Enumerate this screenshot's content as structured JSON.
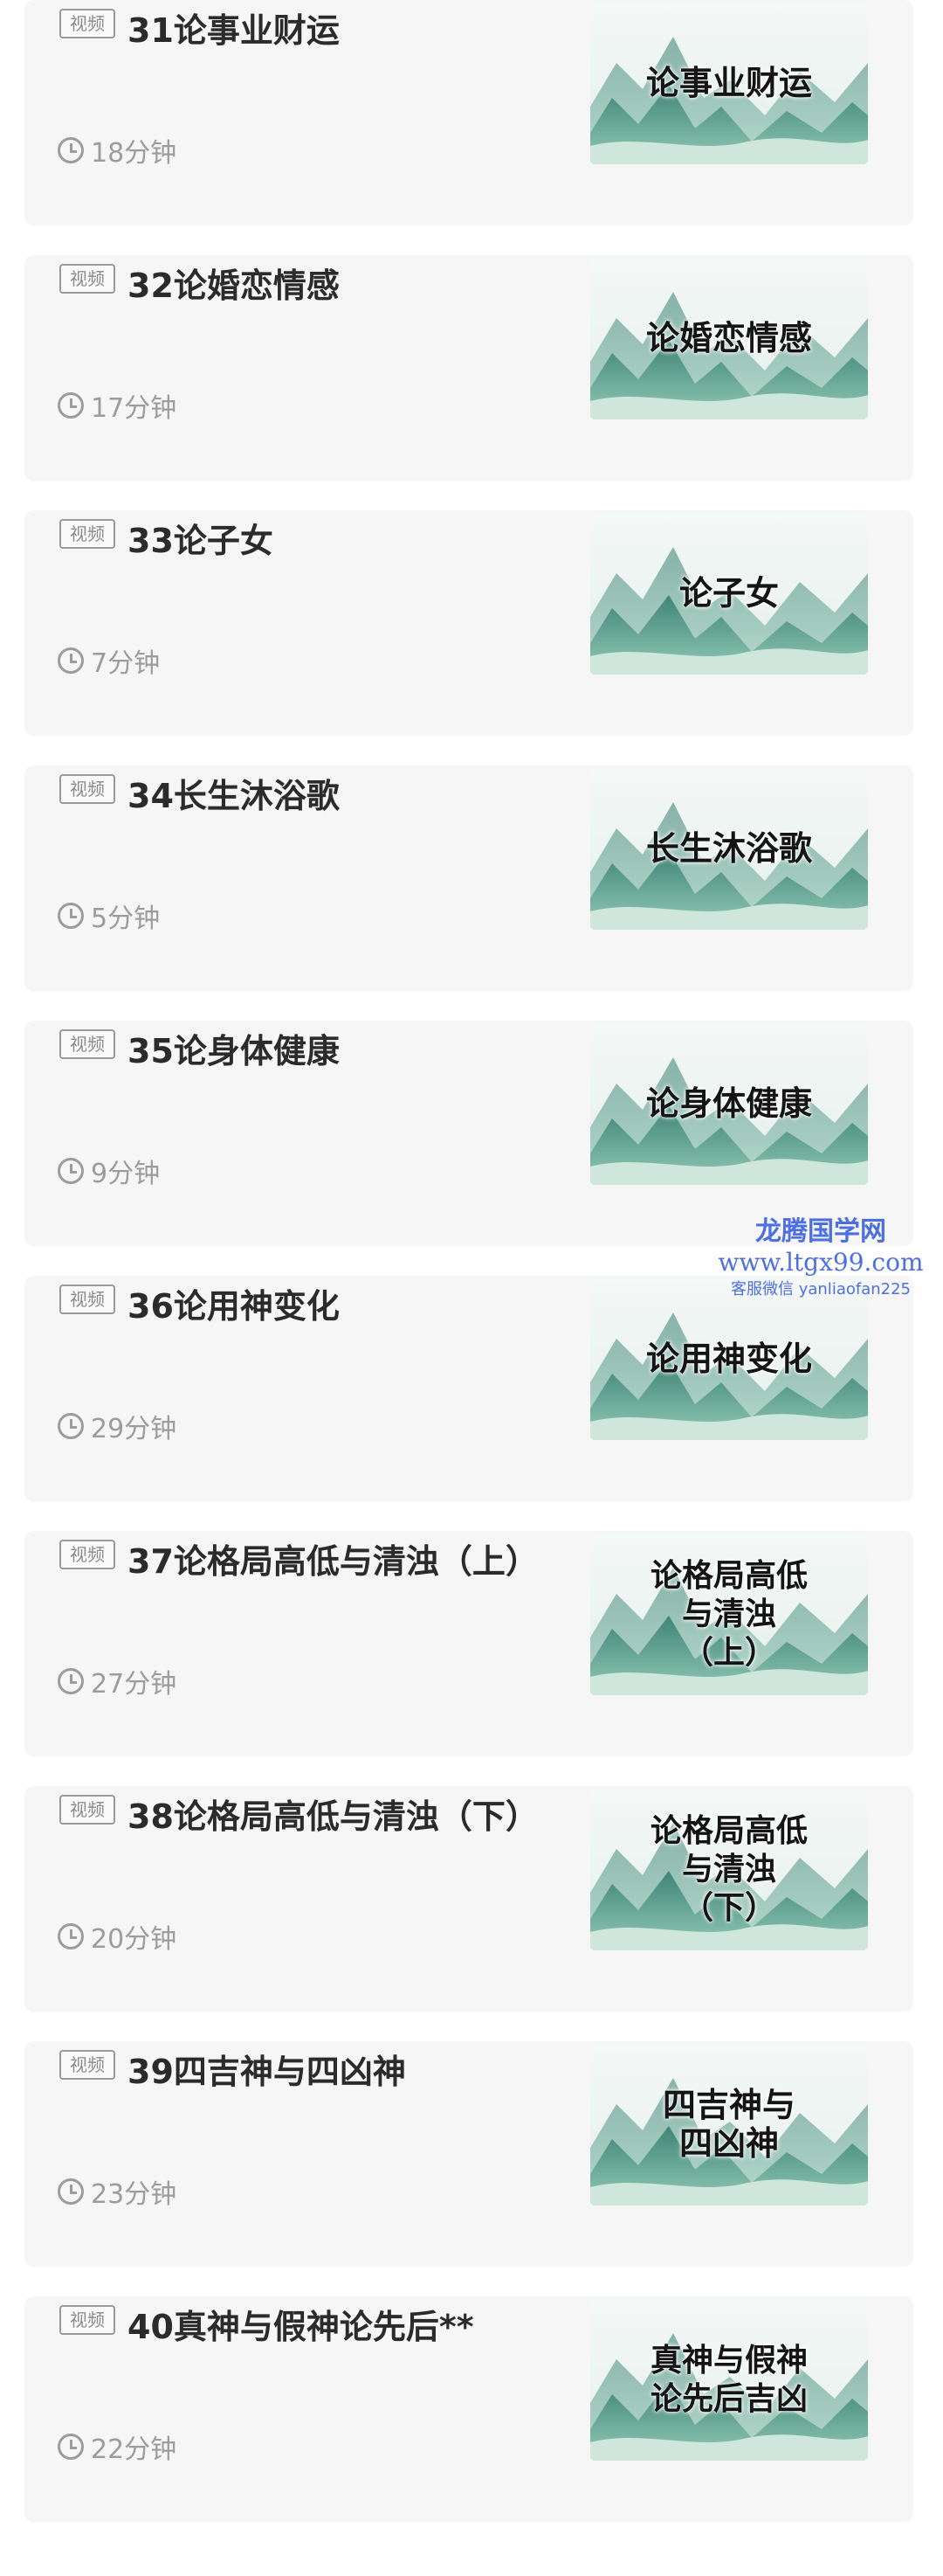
{
  "items": [
    {
      "badge": "视频",
      "title": "31论事业财运",
      "duration": "18分钟",
      "thumb": "论事业财运"
    },
    {
      "badge": "视频",
      "title": "32论婚恋情感",
      "duration": "17分钟",
      "thumb": "论婚恋情感"
    },
    {
      "badge": "视频",
      "title": "33论子女",
      "duration": "7分钟",
      "thumb": "论子女"
    },
    {
      "badge": "视频",
      "title": "34长生沐浴歌",
      "duration": "5分钟",
      "thumb": "长生沐浴歌"
    },
    {
      "badge": "视频",
      "title": "35论身体健康",
      "duration": "9分钟",
      "thumb": "论身体健康"
    },
    {
      "badge": "视频",
      "title": "36论用神变化",
      "duration": "29分钟",
      "thumb": "论用神变化"
    },
    {
      "badge": "视频",
      "title": "37论格局高低与清浊（上）",
      "duration": "27分钟",
      "thumb": "论格局高低\n与清浊\n（上）"
    },
    {
      "badge": "视频",
      "title": "38论格局高低与清浊（下）",
      "duration": "20分钟",
      "thumb": "论格局高低\n与清浊\n（下）"
    },
    {
      "badge": "视频",
      "title": "39四吉神与四凶神",
      "duration": "23分钟",
      "thumb": "四吉神与\n四凶神"
    },
    {
      "badge": "视频",
      "title": "40真神与假神论先后**",
      "duration": "22分钟",
      "thumb": "真神与假神\n论先后吉凶"
    }
  ],
  "watermark": {
    "name": "龙腾国学网",
    "url": "www.ltgx99.com",
    "contact": "客服微信 yanliaofan225"
  },
  "colors": {
    "card_bg": "#f6f6f6",
    "title": "#2b2b2b",
    "muted": "#9c9c9c",
    "watermark": "#4d6fe0",
    "mountain_dark": "#2f7a6a",
    "mountain_light": "#8fc8b4"
  }
}
